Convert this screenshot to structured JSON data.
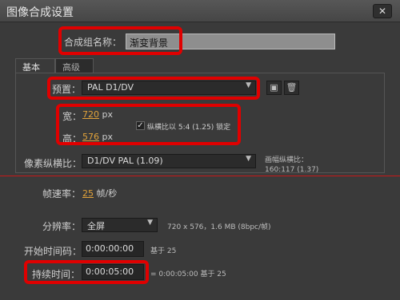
{
  "window": {
    "title": "图像合成设置",
    "close_glyph": "✕"
  },
  "comp_name": {
    "label": "合成组名称：",
    "value": "渐变背景"
  },
  "tabs": [
    {
      "label": "基本"
    },
    {
      "label": "高级"
    }
  ],
  "preset": {
    "label": "预置：",
    "value": "PAL D1/DV"
  },
  "size": {
    "width_label": "宽：",
    "width_value": "720",
    "width_unit": "px",
    "height_label": "高：",
    "height_value": "576",
    "height_unit": "px",
    "lock_label": "纵横比以 5:4 (1.25) 锁定",
    "lock_checked": true
  },
  "pixel_aspect": {
    "label": "像素纵横比：",
    "value": "D1/DV PAL (1.09)",
    "info_label": "画幅纵横比：",
    "info_value": "160:117 (1.37)"
  },
  "frame_rate": {
    "label": "帧速率：",
    "value": "25",
    "unit": "帧/秒"
  },
  "resolution": {
    "label": "分辨率：",
    "value": "全屏",
    "info": "720 x 576，1.6 MB (8bpc/帧)"
  },
  "start_timecode": {
    "label": "开始时间码：",
    "value": "0:00:00:00",
    "info": "基于 25"
  },
  "duration": {
    "label": "持续时间：",
    "value": "0:00:05:00",
    "info": "= 0:00:05:00  基于 25"
  },
  "icons": {
    "dropdown": "▼",
    "check": "✓",
    "copy": "▣",
    "trash": "🗑"
  },
  "colors": {
    "highlight": "#e00000",
    "accent": "#e0a23a"
  }
}
